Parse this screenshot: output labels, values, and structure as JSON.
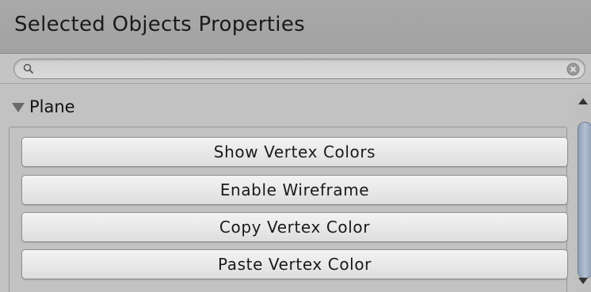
{
  "window": {
    "title": "Selected Objects Properties"
  },
  "search": {
    "value": "",
    "placeholder": "",
    "search_icon": "search-icon",
    "clear_icon": "clear-icon"
  },
  "foldout": {
    "label": "Plane",
    "expanded": true
  },
  "buttons": [
    {
      "label": "Show Vertex Colors"
    },
    {
      "label": "Enable Wireframe"
    },
    {
      "label": "Copy Vertex Color"
    },
    {
      "label": "Paste Vertex Color"
    }
  ],
  "colors": {
    "header_bg": "#a6a6a6",
    "panel_bg": "#c2c2c2",
    "scroll_thumb": "#a3b1c4"
  }
}
